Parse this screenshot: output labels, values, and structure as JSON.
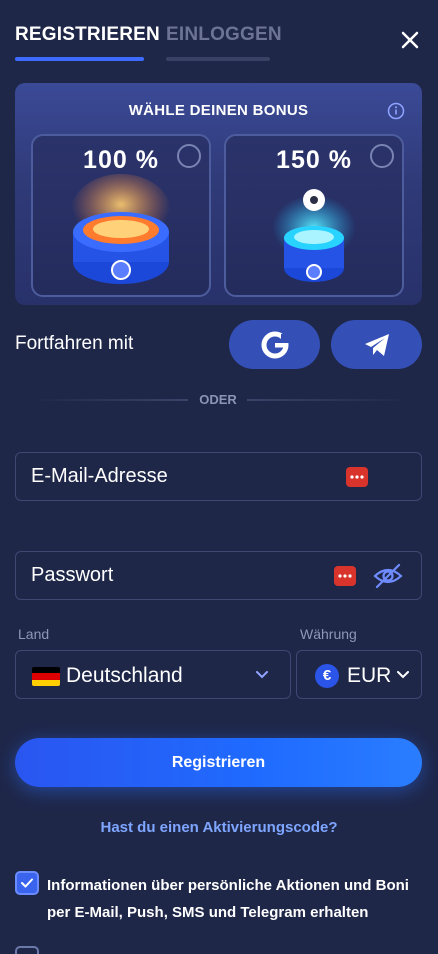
{
  "tabs": {
    "register": "REGISTRIEREN",
    "login": "EINLOGGEN"
  },
  "bonus": {
    "title": "WÄHLE DEINEN BONUS",
    "options": [
      {
        "percent": "100 %"
      },
      {
        "percent": "150 %"
      }
    ]
  },
  "social": {
    "label": "Fortfahren mit",
    "divider": "ODER"
  },
  "form": {
    "email_placeholder": "E-Mail-Adresse",
    "password_placeholder": "Passwort",
    "country_label": "Land",
    "country_value": "Deutschland",
    "currency_label": "Währung",
    "currency_symbol": "€",
    "currency_value": "EUR"
  },
  "actions": {
    "register": "Registrieren",
    "activation_code": "Hast du einen Aktivierungscode?"
  },
  "consent": {
    "text": "Informationen über persönliche Aktionen und Boni per E-Mail, Push, SMS und Telegram erhalten",
    "checked": true
  },
  "colors": {
    "background": "#1f2749",
    "accent": "#3d6bff",
    "button": "#1f6bff"
  },
  "icons": {
    "close": "close-icon",
    "info": "info-icon",
    "google": "google-icon",
    "telegram": "telegram-icon",
    "password_manager": "password-dots-icon",
    "visibility": "eye-off-icon",
    "chevron": "chevron-down-icon"
  }
}
